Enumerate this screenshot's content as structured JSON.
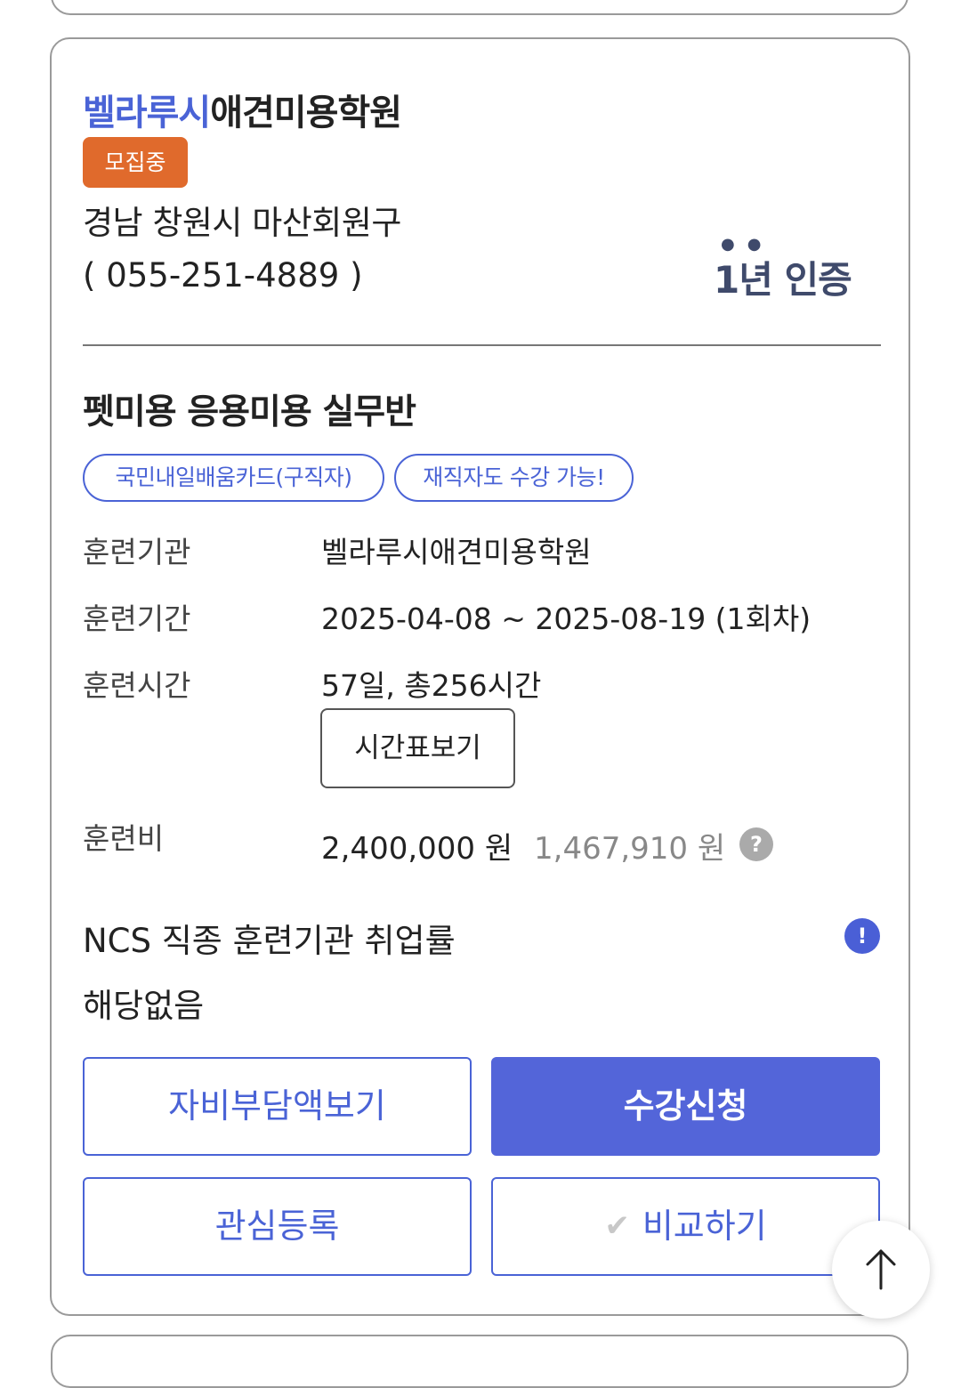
{
  "institution": {
    "name_highlight": "벨라루시",
    "name_rest": "애견미용학원",
    "status_badge": "모집중",
    "address": "경남 창원시 마산회원구",
    "phone": "( 055-251-4889 )",
    "cert_text": "1년 인증"
  },
  "course": {
    "title": "펫미용 응용미용 실무반",
    "tags": [
      "국민내일배움카드(구직자)",
      "재직자도 수강 가능!"
    ],
    "labels": {
      "institution": "훈련기관",
      "period": "훈련기간",
      "hours": "훈련시간",
      "fee": "훈련비"
    },
    "values": {
      "institution": "벨라루시애견미용학원",
      "period": "2025-04-08 ~ 2025-08-19 (1회차)",
      "hours": "57일, 총256시간",
      "fee_original": "2,400,000 원",
      "fee_subsidized": "1,467,910 원"
    },
    "timetable_button": "시간표보기",
    "fee_help_icon": "question-circle-icon"
  },
  "ncs": {
    "title": "NCS 직종 훈련기관 취업률",
    "value": "해당없음",
    "info_icon": "exclamation-circle-icon"
  },
  "buttons": {
    "self_pay": "자비부담액보기",
    "apply": "수강신청",
    "interest": "관심등록",
    "compare": "비교하기"
  },
  "colors": {
    "accent": "#4a63d6",
    "primary_button": "#5365d9",
    "badge": "#e06a2c"
  }
}
